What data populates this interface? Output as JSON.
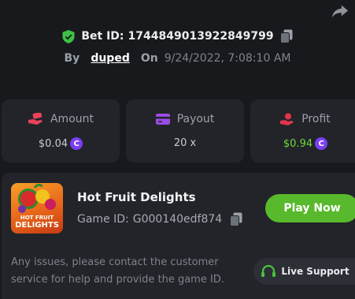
{
  "bet": {
    "label": "Bet ID:",
    "id": "1744849013922849799",
    "by_label": "By",
    "user": "duped",
    "on_label": "On",
    "datetime": "9/24/2022, 7:08:10 AM"
  },
  "stats": {
    "amount": {
      "label": "Amount",
      "value": "$0.04"
    },
    "payout": {
      "label": "Payout",
      "value": "20 x"
    },
    "profit": {
      "label": "Profit",
      "value": "$0.94"
    }
  },
  "game": {
    "title": "Hot Fruit Delights",
    "id_label": "Game ID:",
    "id": "G000140edf874",
    "thumb_text_line1": "HOT FRUIT",
    "thumb_text_line2": "DELIGHTS",
    "play_label": "Play Now"
  },
  "support": {
    "message": "Any issues, please contact the customer service for help and provide the game ID.",
    "button_label": "Live Support"
  },
  "colors": {
    "accent_green": "#58b92c",
    "profit_green": "#6fdc3a",
    "coin_purple": "#7b3ff2",
    "amount_red": "#e8435a",
    "payout_purple": "#9a4ce6",
    "profit_red": "#e0344a"
  },
  "icons": {
    "share": "share-arrow-icon",
    "verified": "shield-check-icon",
    "copy": "copy-icon",
    "amount": "money-hand-icon",
    "payout": "card-icon",
    "profit": "hand-coin-icon",
    "coin": "coin-icon",
    "support": "headset-icon"
  }
}
